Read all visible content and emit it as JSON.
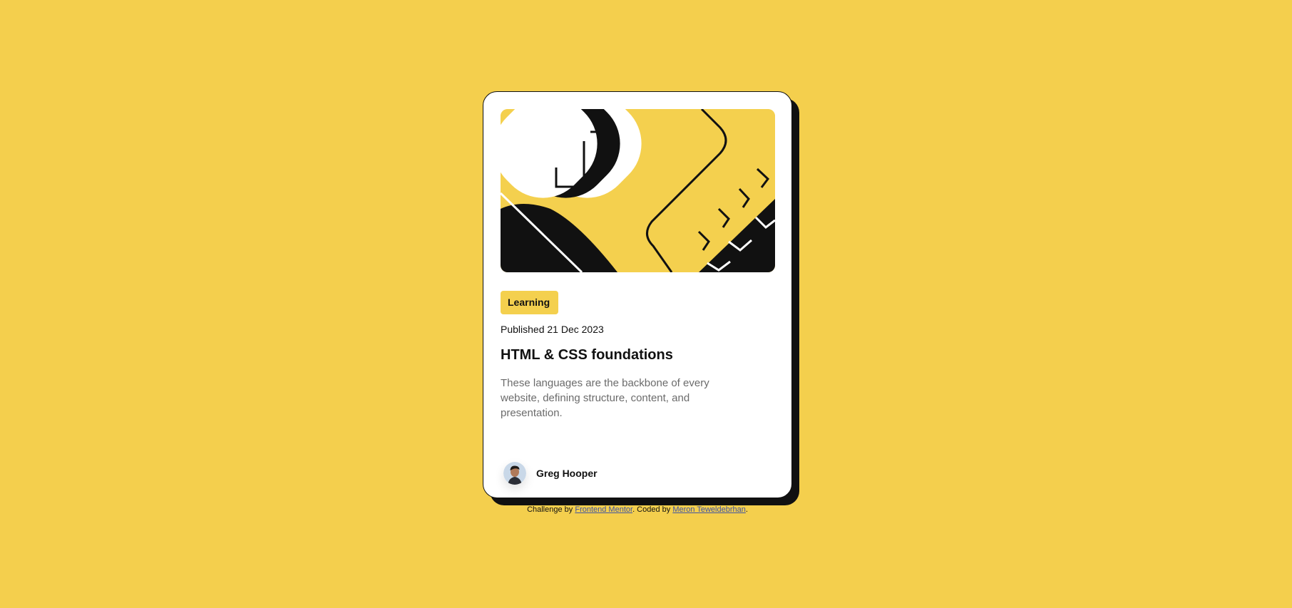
{
  "card": {
    "category": "Learning",
    "published": "Published 21 Dec 2023",
    "title": "HTML & CSS foundations",
    "description": "These languages are the backbone of every website, defining structure, content, and presentation.",
    "author": {
      "name": "Greg Hooper"
    }
  },
  "attribution": {
    "prefix": "Challenge by",
    "link1": "Frontend Mentor",
    "middle": ". Coded by",
    "link2": "Meron Teweldebrhan",
    "suffix": "."
  },
  "colors": {
    "background": "#F4CF4D",
    "card": "#FFFFFF",
    "accent": "#F4D04E",
    "ink": "#111111",
    "muted": "#6B6B6B",
    "link": "#3E52A3"
  }
}
